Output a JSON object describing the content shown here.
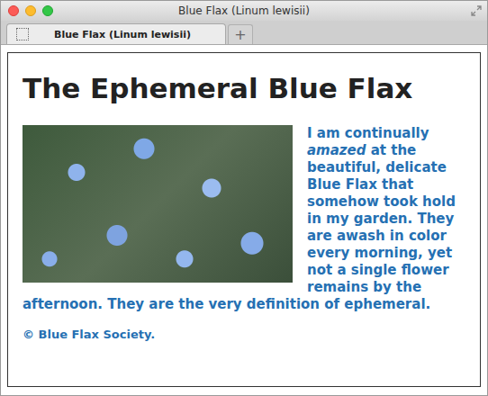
{
  "window": {
    "title": "Blue Flax (Linum lewisii)"
  },
  "tabs": [
    {
      "label": "Blue Flax (Linum lewisii)",
      "selected": true
    }
  ],
  "new_tab_button": "+",
  "page": {
    "heading": "The Ephemeral Blue Flax",
    "paragraph": [
      {
        "text": "I am continually ",
        "emphasis": false
      },
      {
        "text": "amazed",
        "emphasis": true
      },
      {
        "text": " at the beautiful, delicate Blue Flax that somehow took hold in my garden. They are awash in color every morning, yet not a single flower remains by the afternoon. They are the very definition of ephemeral.",
        "emphasis": false
      }
    ],
    "footer": "© Blue Flax Society."
  }
}
